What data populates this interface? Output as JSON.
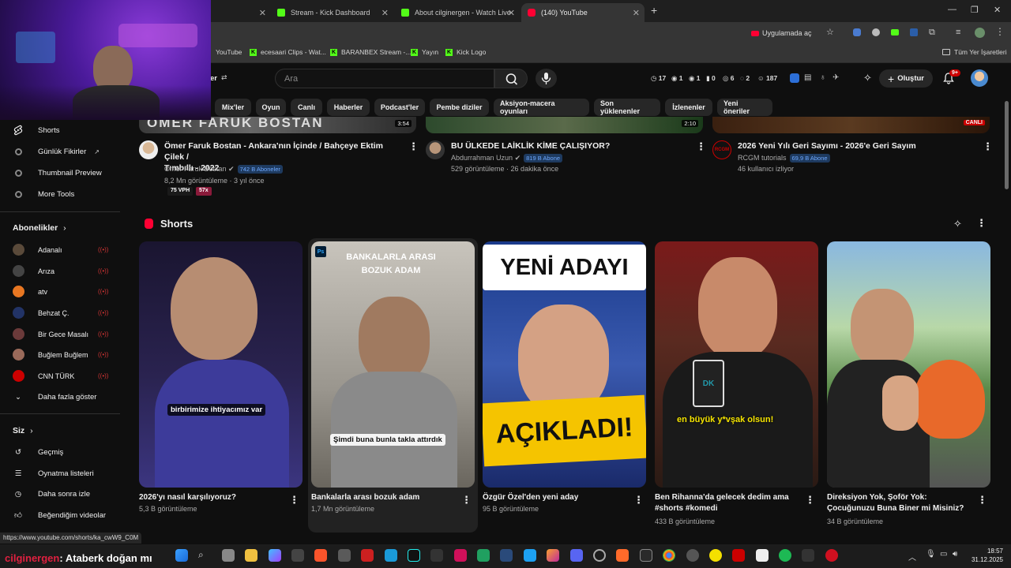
{
  "browser": {
    "tabs": [
      {
        "label": "Stream - Kick Dashboard"
      },
      {
        "label": "About cilginergen - Watch Live"
      },
      {
        "label": "(140) YouTube"
      }
    ],
    "new_tab": "+",
    "open_in_app": "Uygulamada aç",
    "bookmarks": [
      "YouTube",
      "ecesaari Clips - Wat...",
      "BARANBEX Stream -...",
      "Yayın",
      "Kick Logo"
    ],
    "all_bookmarks": "Tüm Yer İşaretleri"
  },
  "youtube": {
    "header": {
      "filter_label": "er",
      "search_placeholder": "Ara",
      "stats": [
        "17",
        "1",
        "1",
        "0",
        "6",
        "2",
        "187"
      ],
      "create_label": "Oluştur",
      "notif_count": "9+"
    },
    "chips": [
      "Mix'ler",
      "Oyun",
      "Canlı",
      "Haberler",
      "Podcast'ler",
      "Pembe diziler",
      "Aksiyon-macera oyunları",
      "Son yüklenenler",
      "İzlenenler",
      "Yeni öneriler"
    ],
    "sidebar": {
      "items_top": [
        {
          "label": "Shorts",
          "icon": "shorts-icon"
        },
        {
          "label": "Günlük Fikirler",
          "icon": "ext-icon"
        },
        {
          "label": "Thumbnail Preview",
          "icon": "ext-icon"
        },
        {
          "label": "More Tools",
          "icon": "ext-icon"
        }
      ],
      "subscriptions_title": "Abonelikler",
      "channels": [
        {
          "label": "Adanalı",
          "color": "#5a4a3a"
        },
        {
          "label": "Arıza",
          "color": "#444444"
        },
        {
          "label": "atv",
          "color": "#e87722"
        },
        {
          "label": "Behzat Ç.",
          "color": "#223366"
        },
        {
          "label": "Bir Gece Masalı",
          "color": "#6b3a3a"
        },
        {
          "label": "Buğlem Buğlem",
          "color": "#9a6a5a"
        },
        {
          "label": "CNN TÜRK",
          "color": "#cc0000"
        }
      ],
      "show_more": "Daha fazla göster",
      "you_title": "Siz",
      "you_items": [
        {
          "label": "Geçmiş",
          "icon": "history-icon"
        },
        {
          "label": "Oynatma listeleri",
          "icon": "playlist-icon"
        },
        {
          "label": "Daha sonra izle",
          "icon": "clock-icon"
        },
        {
          "label": "Beğendiğim videolar",
          "icon": "like-icon"
        }
      ]
    },
    "videos": [
      {
        "title_line1": "Ömer Faruk Bostan - Ankara'nın İçinde / Bahçeye Ektim Çilek /",
        "title_line2": "Tımbıllı - 2022",
        "channel": "Ömer Faruk Bostan",
        "subs": "742 B Aboneler",
        "meta": "8,2 Mn görüntüleme · 3 yıl önce",
        "badge1": "75 VPH",
        "badge2": "57x",
        "duration": "3:54"
      },
      {
        "title_line1": "BU ÜLKEDE LAİKLİK KİME ÇALIŞIYOR?",
        "title_line2": "",
        "channel": "Abdurrahman Uzun",
        "subs": "819 B Abone",
        "meta": "529 görüntüleme · 26 dakika önce",
        "duration": "2:10"
      },
      {
        "title_line1": "2026 Yeni Yılı Geri Sayımı - 2026'e Geri Sayım",
        "title_line2": "",
        "channel": "RCGM tutorials",
        "subs": "69,9 B Abone",
        "meta": "46 kullanıcı izliyor",
        "live_label": "CANLI"
      }
    ],
    "shorts_title": "Shorts",
    "shorts": [
      {
        "title": "2026'yı nasıl karşılıyoruz?",
        "views": "5,3 B görüntüleme",
        "caption": "birbirimize ihtiyacımız var"
      },
      {
        "title": "Bankalarla arası bozuk adam",
        "views": "1,7 Mn görüntüleme",
        "caption": "Şimdi buna bunla takla attırdık",
        "overlay": "BANKALARLA ARASI BOZUK ADAM"
      },
      {
        "title": "Özgür Özel'den yeni aday",
        "views": "95 B görüntüleme",
        "overlay_top": "YENİ ADAYI",
        "overlay_bottom": "AÇIKLADI!"
      },
      {
        "title_line1": "Ben Rihanna'da gelecek dedim ama",
        "title_line2": "#shorts #komedi",
        "views": "433 B görüntüleme",
        "caption": "en büyük y*vşak olsun!"
      },
      {
        "title_line1": "Direksiyon Yok, Şoför Yok:",
        "title_line2": "Çocuğunuzu Buna Biner mi Misiniz?",
        "views": "34 B görüntüleme"
      }
    ]
  },
  "status_url": "https://www.youtube.com/shorts/ka_cwW9_C0M",
  "ticker": {
    "name": "cilginergen",
    "text": ": Ataberk doğan mı"
  },
  "clock": {
    "time": "18:57",
    "date": "31.12.2025"
  },
  "colors": {
    "yt_red": "#ff0033",
    "kick_green": "#53fc18",
    "bg": "#0f0f0f"
  }
}
